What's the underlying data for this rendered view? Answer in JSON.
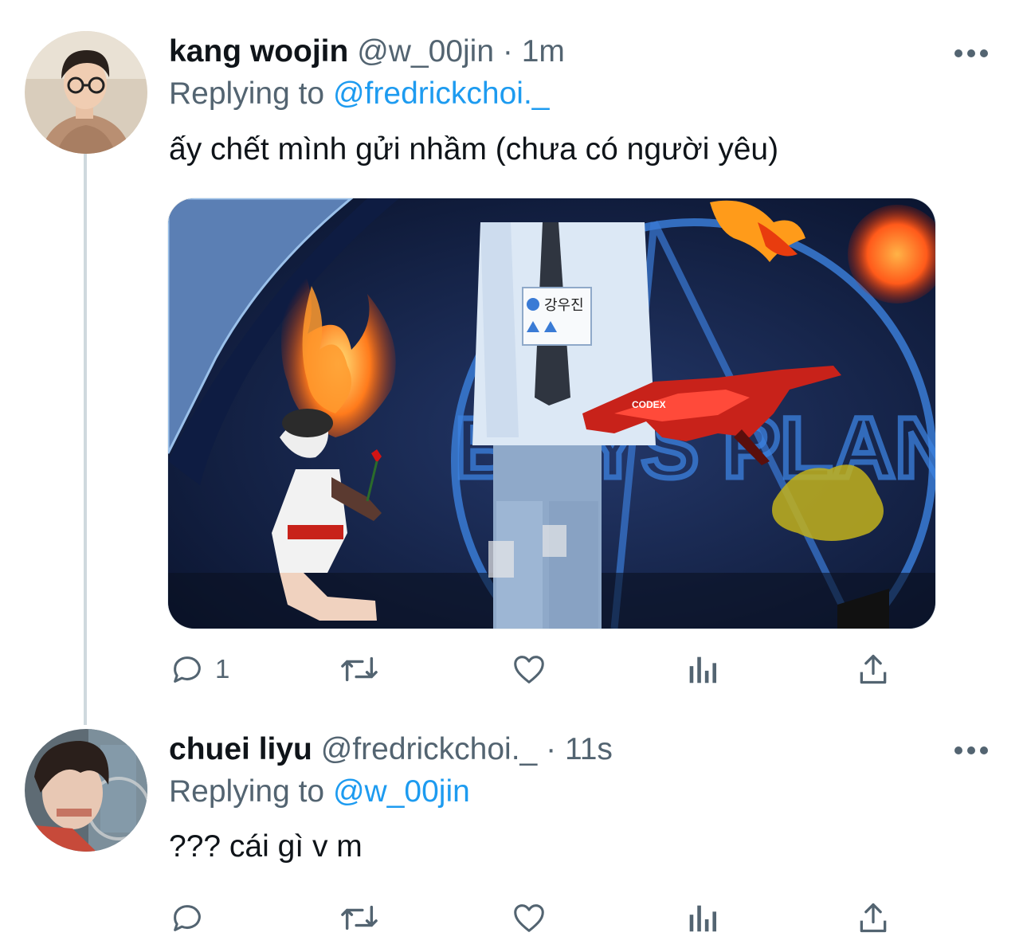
{
  "tweets": [
    {
      "name": "kang woojin",
      "handle": "@w_00jin",
      "separator": "·",
      "time": "1m",
      "replying_prefix": "Replying to",
      "replying_to": "@fredrickchoi._",
      "text": "ấy chết mình gửi nhầm (chưa có người yêu)",
      "media": {
        "badge_hangul": "강우진",
        "backdrop_text": "BOYS PLANET",
        "sticker_text": "CODEX"
      },
      "reply_count": "1"
    },
    {
      "name": "chuei liyu",
      "handle": "@fredrickchoi._",
      "separator": "·",
      "time": "11s",
      "replying_prefix": "Replying to",
      "replying_to": "@w_00jin",
      "text": "??? cái gì v m",
      "reply_count": ""
    }
  ],
  "icons": [
    "reply-icon",
    "retweet-icon",
    "like-icon",
    "views-icon",
    "share-icon",
    "more-icon"
  ],
  "colors": {
    "link": "#1d9bf0",
    "secondary": "#536471",
    "thread_line": "#cfd9de",
    "primary_text": "#0f1419"
  }
}
